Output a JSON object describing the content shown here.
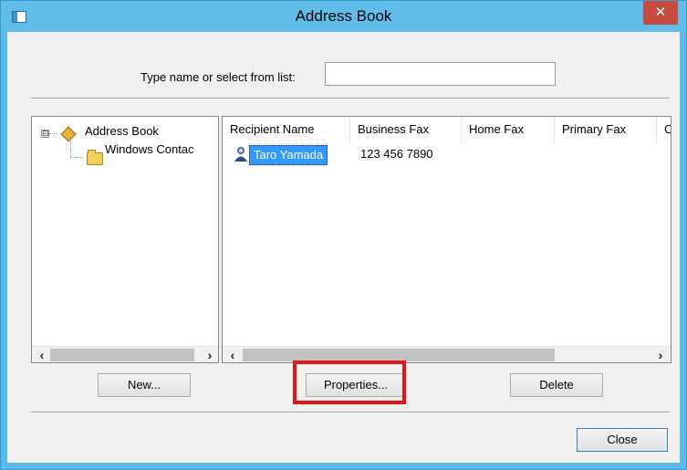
{
  "window": {
    "title": "Address Book",
    "close_glyph": "✕"
  },
  "search": {
    "label": "Type name or select from list:",
    "value": ""
  },
  "tree": {
    "root_label": "Address Book",
    "child_label": "Windows Contac",
    "expander_glyph": "⊟"
  },
  "list": {
    "columns": [
      "Recipient Name",
      "Business Fax",
      "Home Fax",
      "Primary Fax",
      "C"
    ],
    "rows": [
      {
        "name": "Taro Yamada",
        "business_fax": "123 456 7890"
      }
    ]
  },
  "scroll": {
    "left_glyph": "‹",
    "right_glyph": "›"
  },
  "buttons": {
    "new": "New...",
    "properties": "Properties...",
    "delete": "Delete",
    "close": "Close"
  },
  "colors": {
    "titlebar": "#60bce9",
    "close_button": "#c74a3e",
    "selection": "#3399ff",
    "highlight": "#e21616"
  },
  "icons": {
    "title": "window-app-icon",
    "close": "close-icon",
    "tree_root": "address-book-icon",
    "tree_child": "folder-icon",
    "contact": "contact-icon"
  }
}
